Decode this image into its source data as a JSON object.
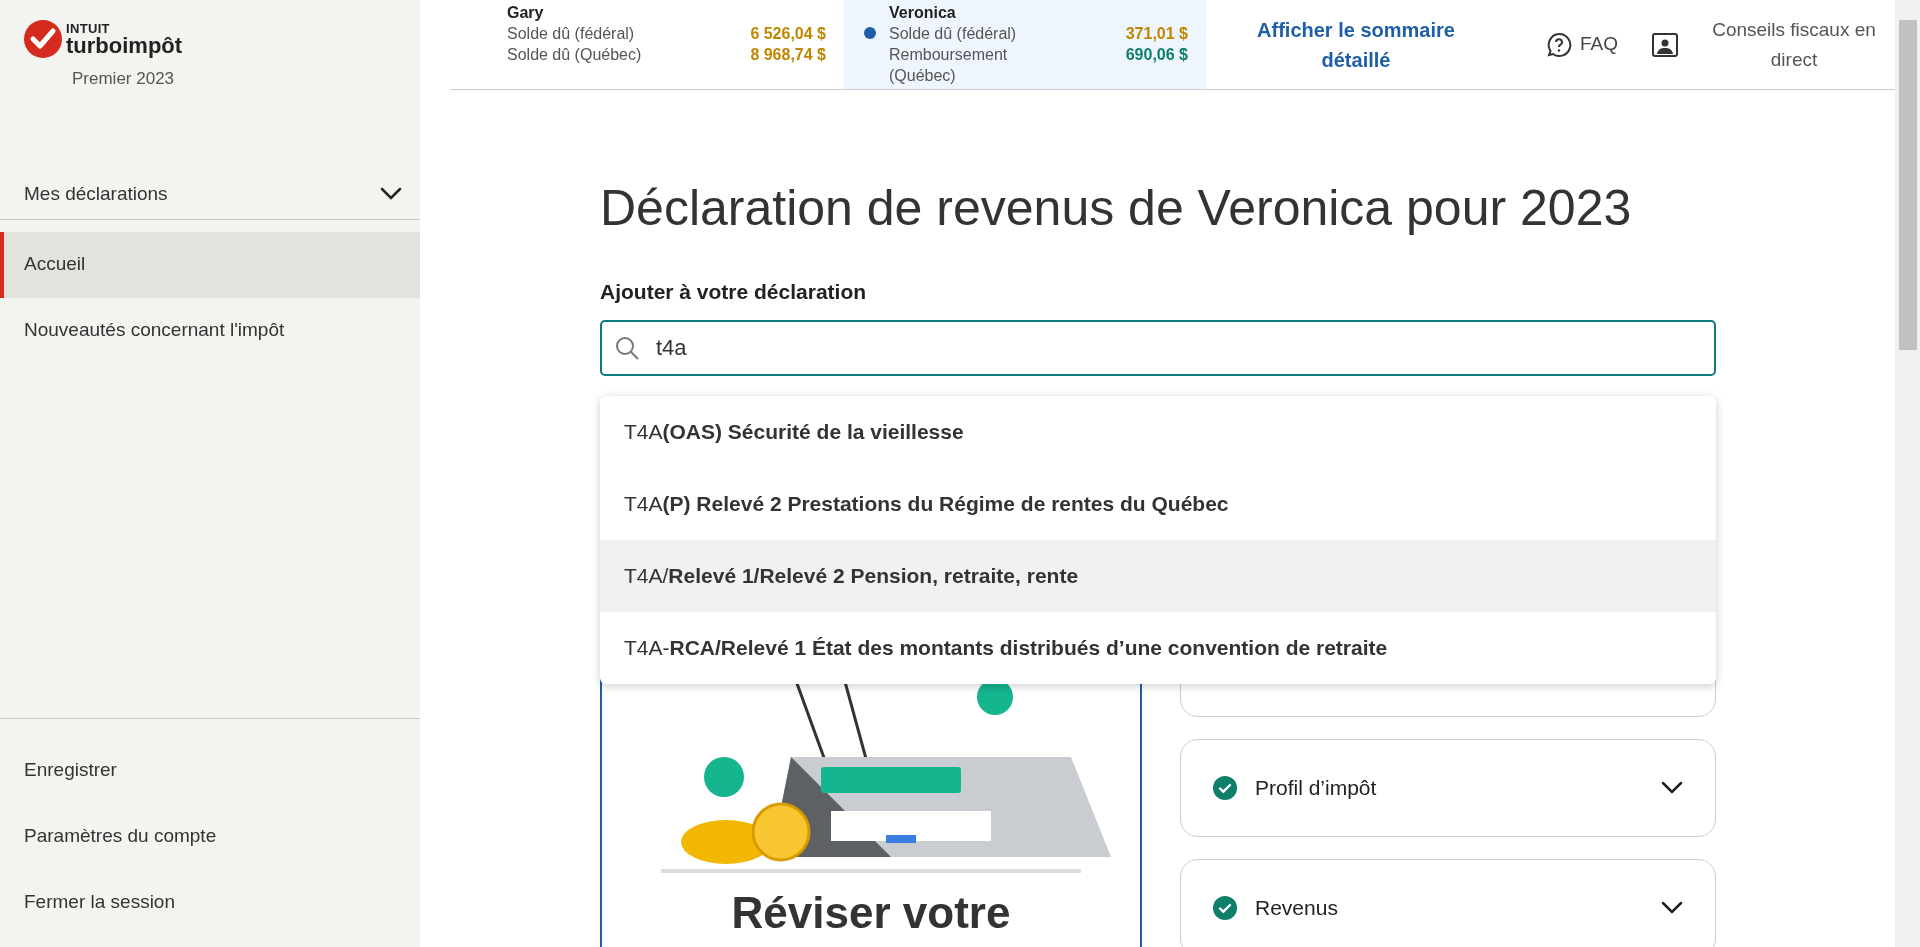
{
  "sidebar": {
    "logo": {
      "brand": "INTUIT",
      "product": "turboimpôt",
      "edition": "Premier 2023"
    },
    "menu": {
      "label": "Mes déclarations",
      "expanded": false
    },
    "items": [
      {
        "label": "Accueil",
        "selected": true
      },
      {
        "label": "Nouveautés concernant l'impôt",
        "selected": false
      }
    ],
    "footer_items": [
      "Enregistrer",
      "Paramètres du compte",
      "Fermer la session"
    ]
  },
  "header": {
    "people": [
      {
        "name": "Gary",
        "selected": false,
        "lines": [
          {
            "label": "Solde dû (fédéral)",
            "amount": "6 526,04 $",
            "kind": "owed"
          },
          {
            "label": "Solde dû (Québec)",
            "amount": "8 968,74 $",
            "kind": "owed"
          }
        ]
      },
      {
        "name": "Veronica",
        "selected": true,
        "lines": [
          {
            "label": "Solde dû (fédéral)",
            "amount": "371,01 $",
            "kind": "owed"
          },
          {
            "label": "Remboursement (Québec)",
            "amount": "690,06 $",
            "kind": "refund"
          }
        ]
      }
    ],
    "summary_link": "Afficher le sommaire détaillé",
    "faq": "FAQ",
    "live_help": "Conseils fiscaux en direct"
  },
  "main": {
    "title": "Déclaration de revenus de Veronica pour 2023",
    "search": {
      "label": "Ajouter à votre déclaration",
      "value": "t4a"
    },
    "suggestions": [
      {
        "text": "T4A**(OAS) Sécurité de la vieillesse**",
        "selected": false
      },
      {
        "text": "T4A**(P) Relevé 2 Prestations du Régime de rentes du Québec**",
        "selected": false
      },
      {
        "text": "T4A/**Relevé 1/Relevé 2 Pension, retraite, rente**",
        "selected": true
      },
      {
        "text": "T4A-**RCA/Relevé 1 État des montants distribués d’une convention de retraite**",
        "selected": false
      }
    ],
    "review_card": {
      "title": "Réviser votre"
    },
    "sections": [
      {
        "label": "Profil d’impôt",
        "done": true,
        "expanded": false
      },
      {
        "label": "Revenus",
        "done": true,
        "expanded": false
      }
    ]
  }
}
